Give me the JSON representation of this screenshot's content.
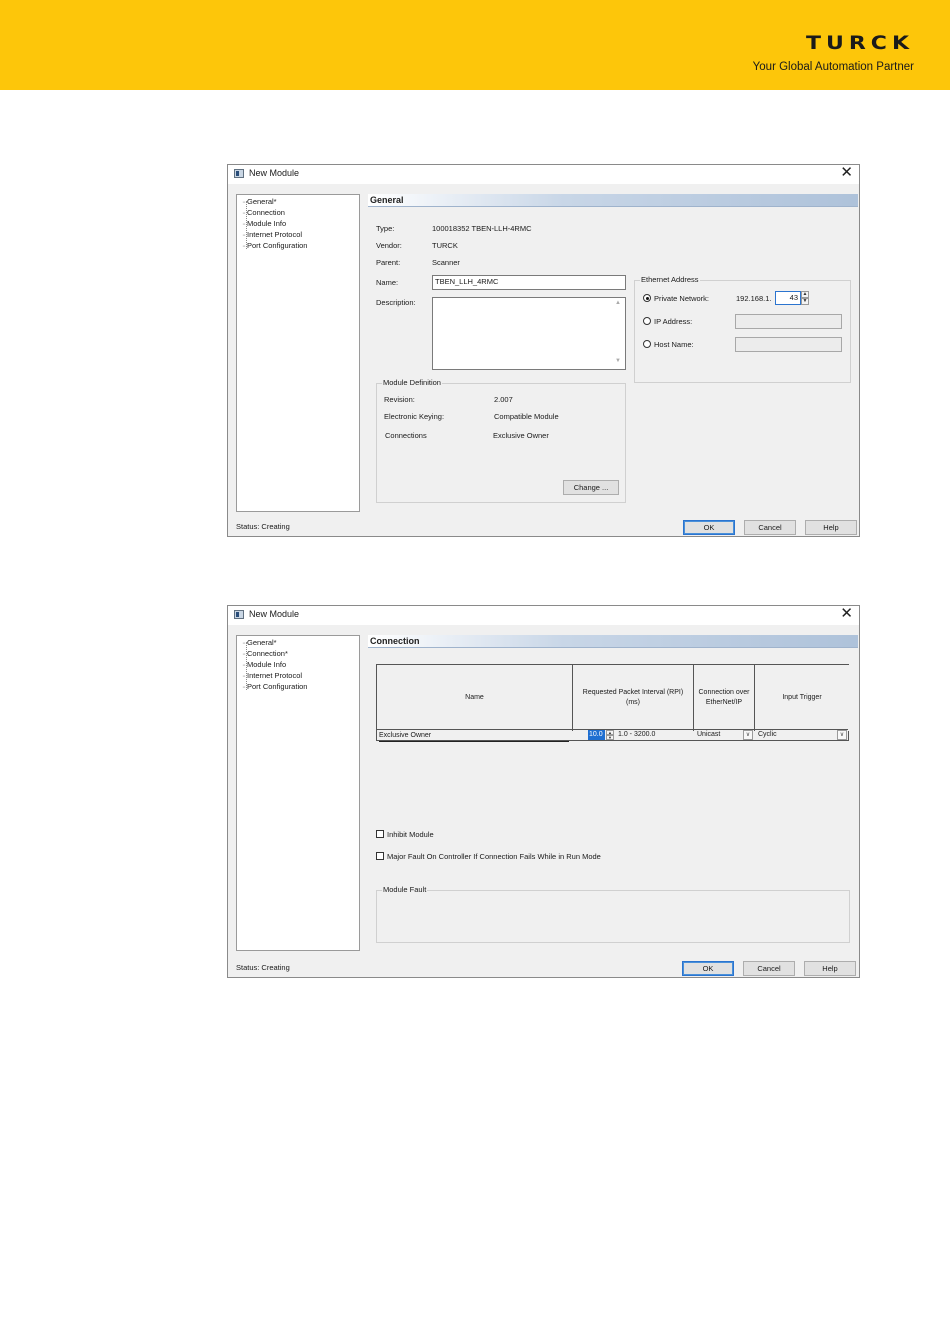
{
  "brand": {
    "logo_text": "TURCK",
    "tagline": "Your Global Automation Partner",
    "banner_color": "#fdc60a"
  },
  "dialog1": {
    "title": "New Module",
    "tree": [
      "General*",
      "Connection",
      "Module Info",
      "Internet Protocol",
      "Port Configuration"
    ],
    "section_title": "General",
    "fields": {
      "type_label": "Type:",
      "type_value": "100018352 TBEN-LLH-4RMC",
      "vendor_label": "Vendor:",
      "vendor_value": "TURCK",
      "parent_label": "Parent:",
      "parent_value": "Scanner",
      "name_label": "Name:",
      "name_value": "TBEN_LLH_4RMC",
      "description_label": "Description:",
      "description_value": ""
    },
    "ethernet": {
      "group_title": "Ethernet Address",
      "private_network_label": "Private Network:",
      "private_network_prefix": "192.168.1.",
      "private_network_octet": "43",
      "ip_address_label": "IP Address:",
      "host_name_label": "Host Name:",
      "selected": "Private Network"
    },
    "module_definition": {
      "group_title": "Module Definition",
      "revision_label": "Revision:",
      "revision_value": "2.007",
      "keying_label": "Electronic Keying:",
      "keying_value": "Compatible Module",
      "connections_label": "Connections",
      "connections_value": "Exclusive Owner",
      "change_button": "Change ..."
    },
    "status_text": "Status:  Creating",
    "ok_button": "OK",
    "cancel_button": "Cancel",
    "help_button": "Help"
  },
  "dialog2": {
    "title": "New Module",
    "tree": [
      "General*",
      "Connection*",
      "Module Info",
      "Internet Protocol",
      "Port Configuration"
    ],
    "section_title": "Connection",
    "table": {
      "columns": [
        "Name",
        "Requested Packet Interval (RPI)\n(ms)",
        "Connection over\nEtherNet/IP",
        "Input Trigger"
      ],
      "rows": [
        {
          "name": "Exclusive Owner",
          "rpi": "10.0",
          "rpi_range": "1.0 - 3200.0",
          "connection": "Unicast",
          "trigger": "Cyclic"
        }
      ]
    },
    "inhibit_label": "Inhibit Module",
    "inhibit_checked": false,
    "major_fault_label": "Major Fault On Controller If Connection Fails While in Run Mode",
    "major_fault_checked": false,
    "module_fault_title": "Module Fault",
    "status_text": "Status:  Creating",
    "ok_button": "OK",
    "cancel_button": "Cancel",
    "help_button": "Help"
  }
}
